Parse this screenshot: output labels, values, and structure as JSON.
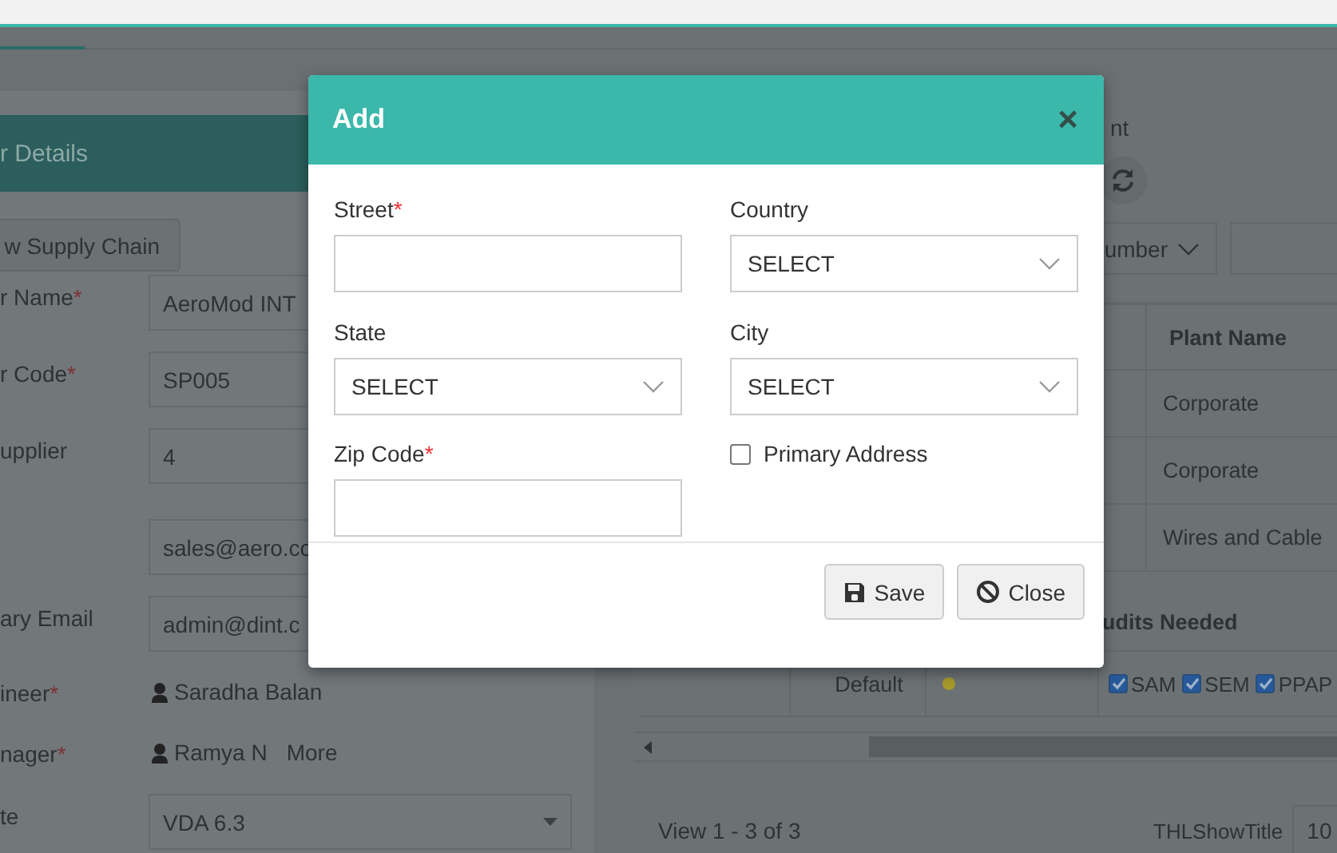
{
  "supplier_panel": {
    "title": "r Details",
    "supply_chain_button": "w Supply Chain",
    "fields": [
      {
        "kind": "text",
        "label": "r Name",
        "required_mark": "*",
        "value": "AeroMod INT"
      },
      {
        "kind": "text",
        "label": "r Code",
        "required_mark": "*",
        "value": "SP005"
      },
      {
        "kind": "text",
        "label": "upplier",
        "value": "4"
      },
      {
        "kind": "text",
        "value": "sales@aero.co"
      },
      {
        "kind": "text",
        "label": "ary Email",
        "value": "admin@dint.c"
      },
      {
        "kind": "person",
        "label": "ineer",
        "required_mark": "*",
        "value": "Saradha Balan"
      },
      {
        "kind": "person",
        "label": "nager",
        "required_mark": "*",
        "value": "Ramya N",
        "link": "More"
      },
      {
        "kind": "select",
        "label": "te",
        "value": "VDA 6.3"
      }
    ]
  },
  "plants_panel": {
    "title": "nt",
    "filter_select": "umber",
    "table": {
      "columns": [
        "Plant Name"
      ],
      "rows": [
        [
          "Corporate"
        ],
        [
          "Corporate"
        ],
        [
          "Wires and Cable"
        ]
      ]
    },
    "audits_table": {
      "columns": [
        "udits Needed"
      ],
      "rows": [
        {
          "type": "Default",
          "color": "#a8992c",
          "audits": [
            {
              "label": "SAM",
              "checked": true
            },
            {
              "label": "SEM",
              "checked": true
            },
            {
              "label": "PPAP",
              "checked": true
            }
          ]
        }
      ]
    },
    "footer": {
      "summary": "View 1 - 3 of 3",
      "page_size_label": "THLShowTitle",
      "page_size": "10"
    }
  },
  "modal": {
    "title": "Add",
    "close_glyph": "×",
    "fields": [
      {
        "kind": "text",
        "label": "Street",
        "required_mark": "*"
      },
      {
        "kind": "select",
        "label": "Country",
        "value": "SELECT"
      },
      {
        "kind": "select",
        "label": "State",
        "value": "SELECT"
      },
      {
        "kind": "select",
        "label": "City",
        "value": "SELECT"
      },
      {
        "kind": "text",
        "label": "Zip Code",
        "required_mark": "*"
      },
      {
        "kind": "checkbox",
        "label": "Primary Address",
        "checked": false
      }
    ],
    "buttons": [
      {
        "kind": "save",
        "label": "Save"
      },
      {
        "kind": "close",
        "label": "Close"
      }
    ]
  }
}
